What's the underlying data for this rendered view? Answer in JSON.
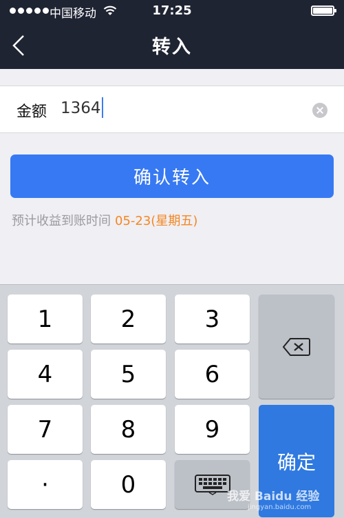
{
  "status_bar": {
    "carrier": "中国移动",
    "time": "17:25"
  },
  "nav": {
    "title": "转入"
  },
  "amount": {
    "label": "金额",
    "value": "1364"
  },
  "confirm_label": "确认转入",
  "estimate": {
    "prefix": "预计收益到账时间",
    "date": "05-23(星期五)"
  },
  "keypad": {
    "keys": [
      "1",
      "2",
      "3",
      "4",
      "5",
      "6",
      "7",
      "8",
      "9",
      "·",
      "0"
    ],
    "confirm_label": "确定"
  },
  "watermark": {
    "text": "我爱 Baidu 经验",
    "sub": "jingyan.baidu.com"
  },
  "colors": {
    "header_bg": "#1f2433",
    "accent_blue": "#3779f2",
    "date_orange": "#f5861f",
    "keypad_bg": "#d1d4d9"
  }
}
